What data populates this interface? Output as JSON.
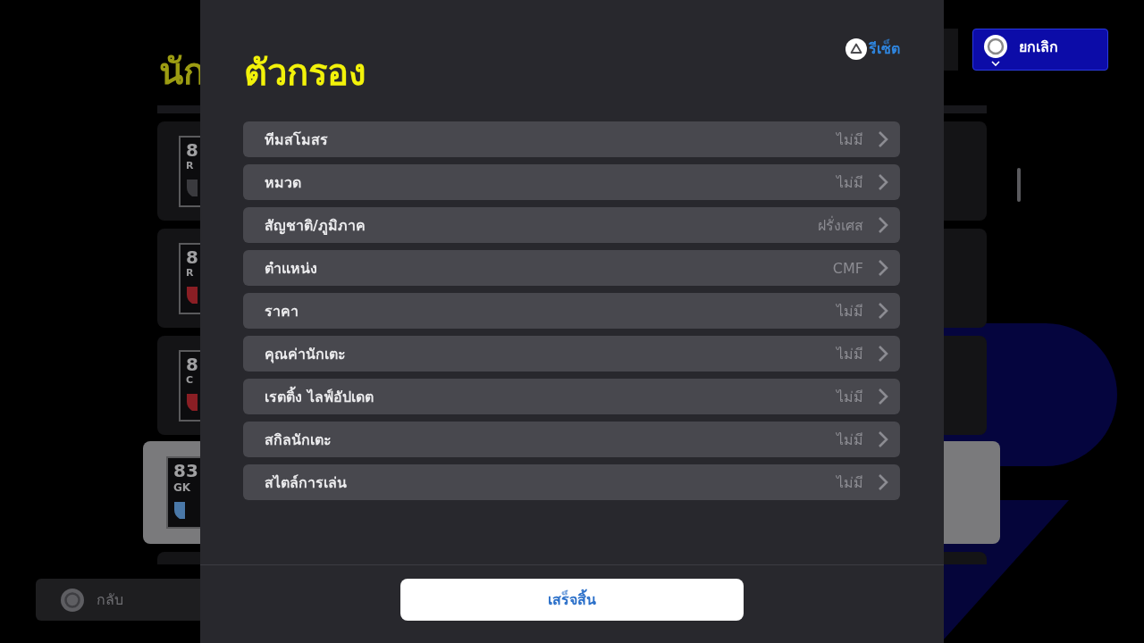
{
  "background_screen": {
    "title": "นัก",
    "cancel_button": {
      "label": "ยกเลิก"
    },
    "player_cards": [
      {
        "rating": "8",
        "position": "R",
        "color": "#3a3a3e",
        "selected": false
      },
      {
        "rating": "8",
        "position": "R",
        "color": "#8a1e24",
        "selected": false
      },
      {
        "rating": "8",
        "position": "C",
        "color": "#8a1e24",
        "selected": false
      },
      {
        "rating": "83",
        "position": "GK",
        "color": "#4a78a8",
        "selected": true
      }
    ],
    "back_button": {
      "label": "กลับ"
    }
  },
  "filter_dialog": {
    "title": "ตัวกรอง",
    "reset_button": {
      "label": "รีเซ็ต"
    },
    "filters": [
      {
        "label": "ทีมสโมสร",
        "value": "ไม่มี"
      },
      {
        "label": "หมวด",
        "value": "ไม่มี"
      },
      {
        "label": "สัญชาติ/ภูมิภาค",
        "value": "ฝรั่งเศส"
      },
      {
        "label": "ตำแหน่ง",
        "value": "CMF"
      },
      {
        "label": "ราคา",
        "value": "ไม่มี"
      },
      {
        "label": "คุณค่านักเตะ",
        "value": "ไม่มี"
      },
      {
        "label": "เรตติ้ง ไลฟ์อัปเดต",
        "value": "ไม่มี"
      },
      {
        "label": "สกิลนักเตะ",
        "value": "ไม่มี"
      },
      {
        "label": "สไตล์การเล่น",
        "value": "ไม่มี"
      }
    ],
    "done_button": {
      "label": "เสร็จสิ้น"
    }
  }
}
